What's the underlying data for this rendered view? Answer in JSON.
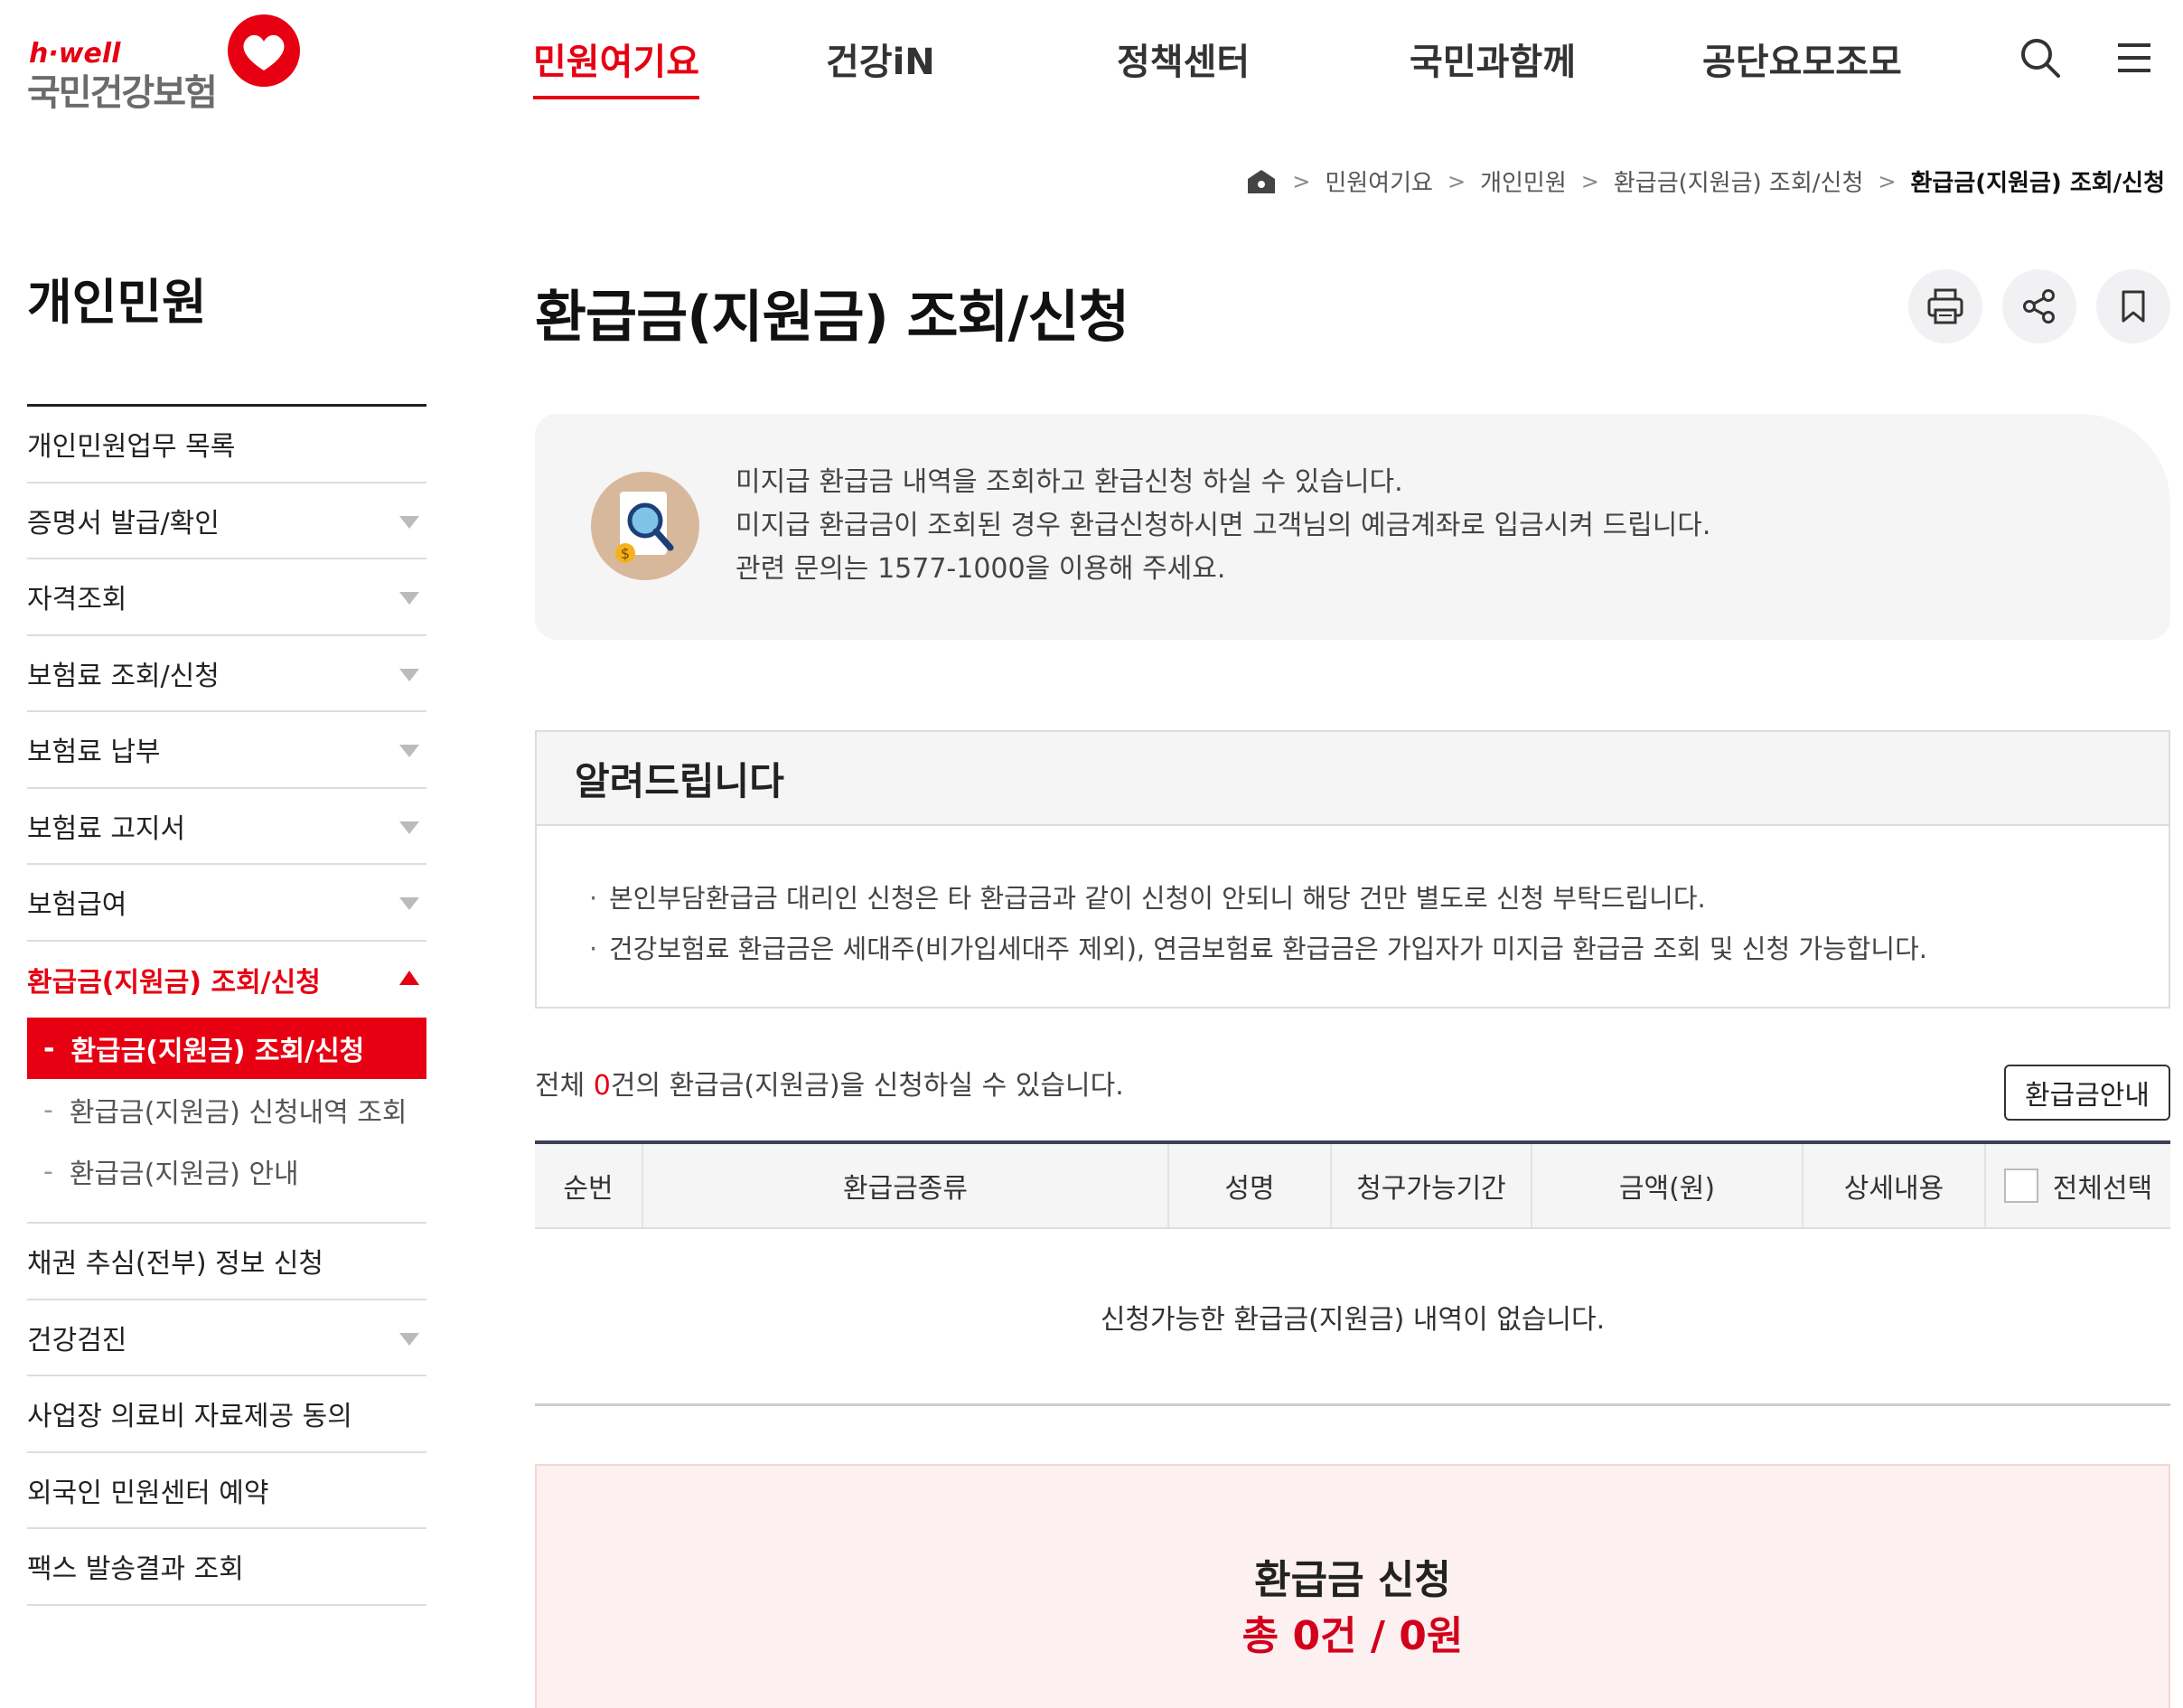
{
  "header": {
    "logo_small": "h·well",
    "logo_main": "국민건강보험",
    "nav": [
      "민원여기요",
      "건강iN",
      "정책센터",
      "국민과함께",
      "공단요모조모"
    ],
    "active_nav": "민원여기요",
    "icons": [
      "search-icon",
      "menu-icon"
    ]
  },
  "breadcrumb": {
    "items": [
      "민원여기요",
      "개인민원",
      "환급금(지원금) 조회/신청",
      "환급금(지원금) 조회/신청"
    ],
    "separator": ">"
  },
  "sidebar": {
    "title": "개인민원",
    "items": [
      {
        "label": "개인민원업무 목록",
        "expandable": false
      },
      {
        "label": "증명서 발급/확인",
        "expandable": true
      },
      {
        "label": "자격조회",
        "expandable": true
      },
      {
        "label": "보험료 조회/신청",
        "expandable": true
      },
      {
        "label": "보험료 납부",
        "expandable": true
      },
      {
        "label": "보험료 고지서",
        "expandable": true
      },
      {
        "label": "보험급여",
        "expandable": true
      },
      {
        "label": "환급금(지원금) 조회/신청",
        "expandable": true,
        "open": true
      },
      {
        "label": "채권 추심(전부) 정보 신청",
        "expandable": false
      },
      {
        "label": "건강검진",
        "expandable": true
      },
      {
        "label": "사업장 의료비 자료제공 동의",
        "expandable": false
      },
      {
        "label": "외국인 민원센터 예약",
        "expandable": false
      },
      {
        "label": "팩스 발송결과 조회",
        "expandable": false
      }
    ],
    "sub_items": [
      {
        "label": "환급금(지원금) 조회/신청",
        "active": true
      },
      {
        "label": "환급금(지원금) 신청내역 조회",
        "active": false
      },
      {
        "label": "환급금(지원금) 안내",
        "active": false
      }
    ],
    "sub_dash": "-"
  },
  "main": {
    "title": "환급금(지원금) 조회/신청",
    "tools": [
      "print-icon",
      "share-icon",
      "bookmark-icon"
    ],
    "info": {
      "icon": "refund-search-icon",
      "lines": [
        "미지급 환급금 내역을 조회하고 환급신청 하실 수 있습니다.",
        "미지급 환급금이 조회된 경우 환급신청하시면 고객님의 예금계좌로 입금시켜 드립니다.",
        "관련 문의는 1577-1000을 이용해 주세요."
      ]
    },
    "notice": {
      "title": "알려드립니다",
      "items": [
        "본인부담환급금 대리인 신청은 타 환급금과 같이 신청이 안되니 해당 건만 별도로 신청 부탁드립니다.",
        "건강보험료 환급금은 세대주(비가입세대주 제외), 연금보험료 환급금은 가입자가 미지급 환급금 조회 및 신청 가능합니다."
      ]
    },
    "total": {
      "prefix": "전체 ",
      "count": "0",
      "suffix": "건의 환급금(지원금)을 신청하실 수 있습니다."
    },
    "guide_button": "환급금안내",
    "table": {
      "headers": [
        "순번",
        "환급금종류",
        "성명",
        "청구가능기간",
        "금액(원)",
        "상세내용",
        "전체선택"
      ],
      "empty_message": "신청가능한 환급금(지원금) 내역이 없습니다."
    },
    "apply": {
      "title": "환급금 신청",
      "total": "총 0건 / 0원"
    }
  },
  "colors": {
    "accent": "#e60012",
    "table_border": "#3a3f55",
    "info_bg": "#f5f5f6",
    "apply_bg": "#fdf0f0"
  }
}
